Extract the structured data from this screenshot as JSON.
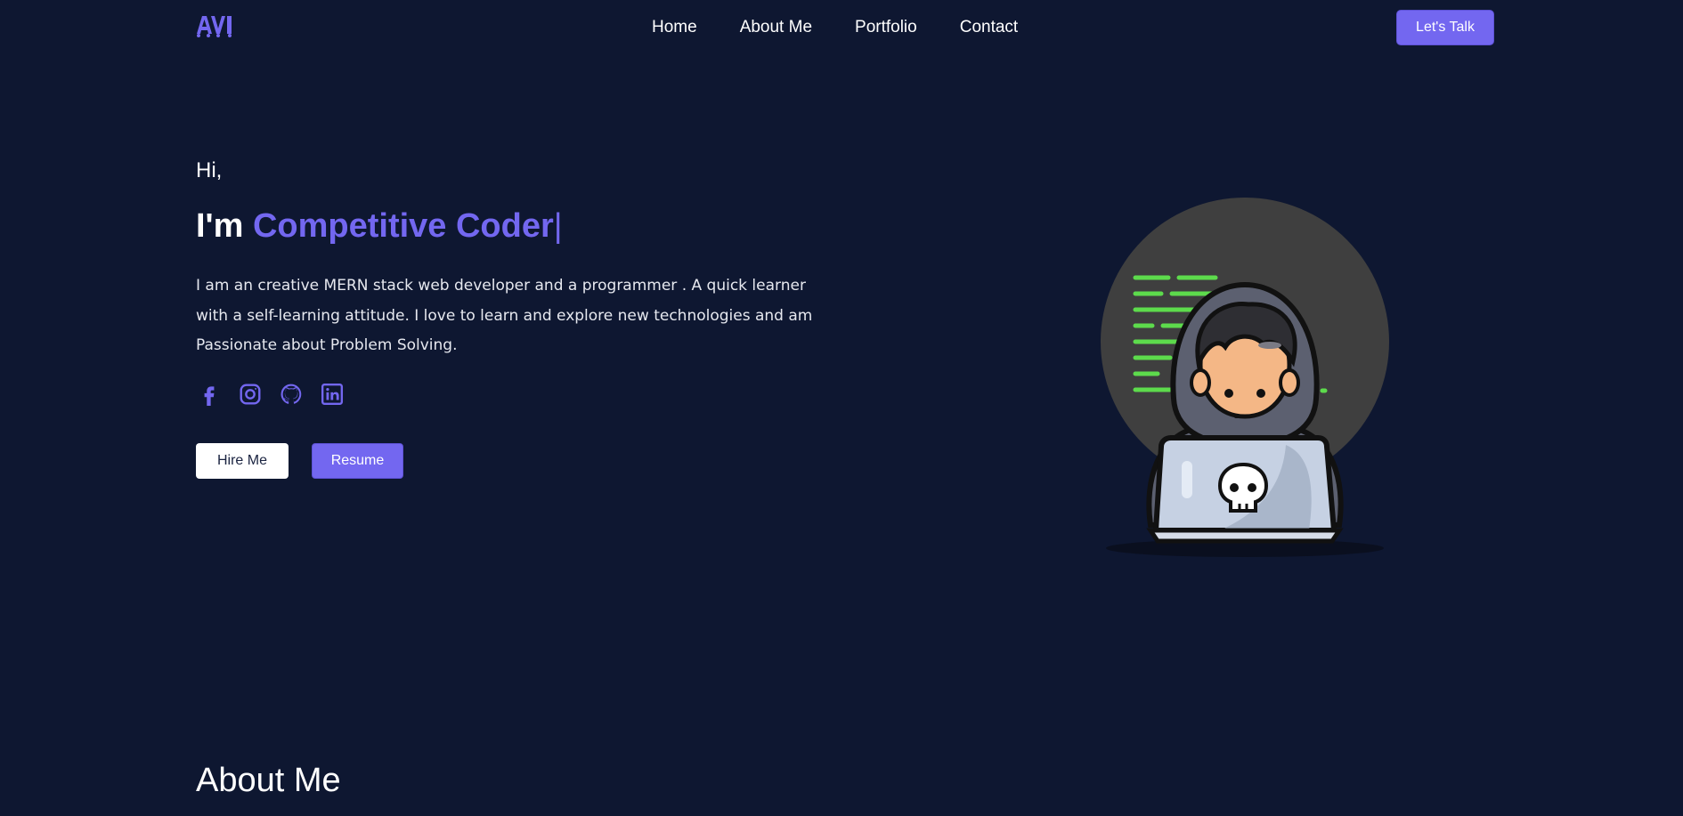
{
  "nav": {
    "logo": "AVI",
    "links": [
      "Home",
      "About Me",
      "Portfolio",
      "Contact"
    ],
    "cta_label": "Let's Talk"
  },
  "hero": {
    "greeting": "Hi,",
    "prefix": "I'm ",
    "role": "Competitive Coder",
    "caret": "|",
    "description": "I am an creative MERN stack web developer and a programmer . A quick learner with a self-learning attitude. I love to learn and explore new technologies and am Passionate about Problem Solving.",
    "socials": [
      "facebook-icon",
      "instagram-icon",
      "github-icon",
      "linkedin-icon"
    ],
    "hire_label": "Hire Me",
    "resume_label": "Resume"
  },
  "about": {
    "title": "About Me"
  },
  "colors": {
    "background": "#0e1731",
    "accent": "#7367f0",
    "code_lines": "#5ddb4c"
  }
}
